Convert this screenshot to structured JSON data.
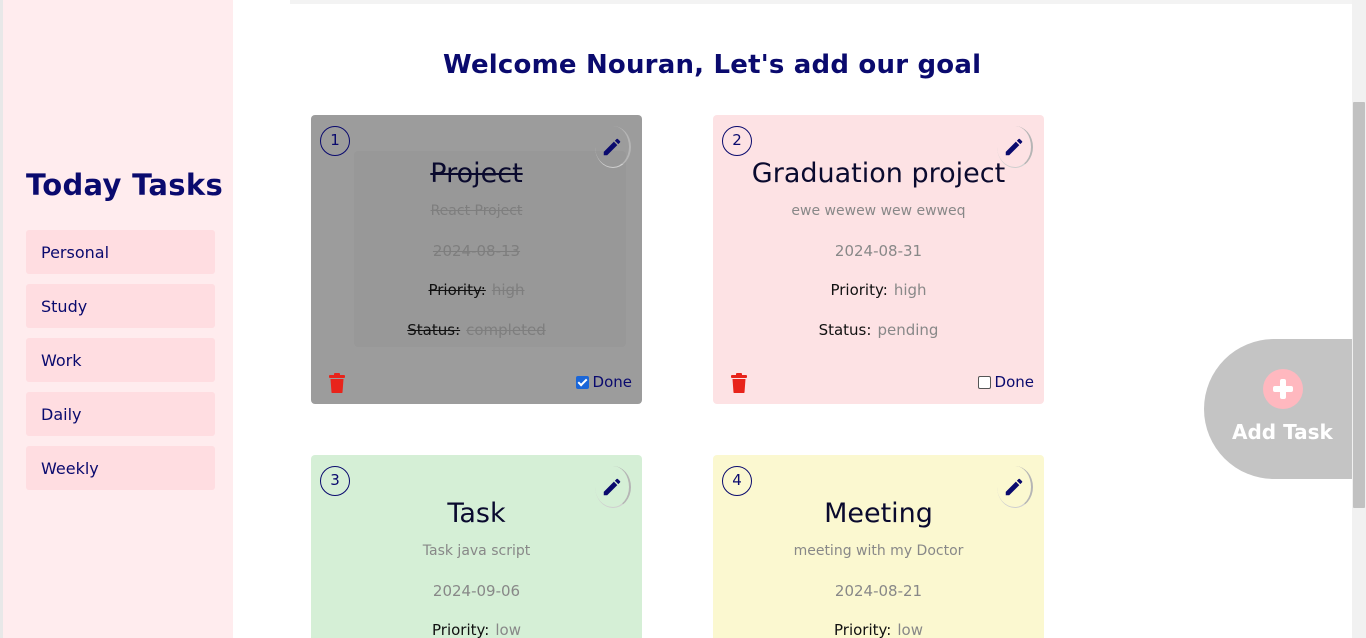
{
  "sidebar": {
    "title": "Today Tasks",
    "items": [
      {
        "label": "Personal"
      },
      {
        "label": "Study"
      },
      {
        "label": "Work"
      },
      {
        "label": "Daily"
      },
      {
        "label": "Weekly"
      }
    ]
  },
  "main": {
    "welcome": "Welcome Nouran, Let's add our goal",
    "priority_label": "Priority:",
    "status_label": "Status:",
    "done_label": "Done",
    "cards": [
      {
        "number": "1",
        "title": "Project",
        "description": "React Project",
        "date": "2024-08-13",
        "priority": "high",
        "status": "completed",
        "done": true,
        "color": "#9c9c9c"
      },
      {
        "number": "2",
        "title": "Graduation project",
        "description": "ewe wewew wew ewweq",
        "date": "2024-08-31",
        "priority": "high",
        "status": "pending",
        "done": false,
        "color": "#fde2e4"
      },
      {
        "number": "3",
        "title": "Task",
        "description": "Task java script",
        "date": "2024-09-06",
        "priority": "low",
        "color": "#d5efd6"
      },
      {
        "number": "4",
        "title": "Meeting",
        "description": "meeting with my Doctor",
        "date": "2024-08-21",
        "priority": "low",
        "color": "#fbf8d0"
      }
    ]
  },
  "add_task": {
    "label": "Add Task",
    "icon": "plus-icon"
  },
  "colors": {
    "accent": "#0a0a6e",
    "sidebar_bg": "#ffecee",
    "trash": "#e8241b"
  }
}
